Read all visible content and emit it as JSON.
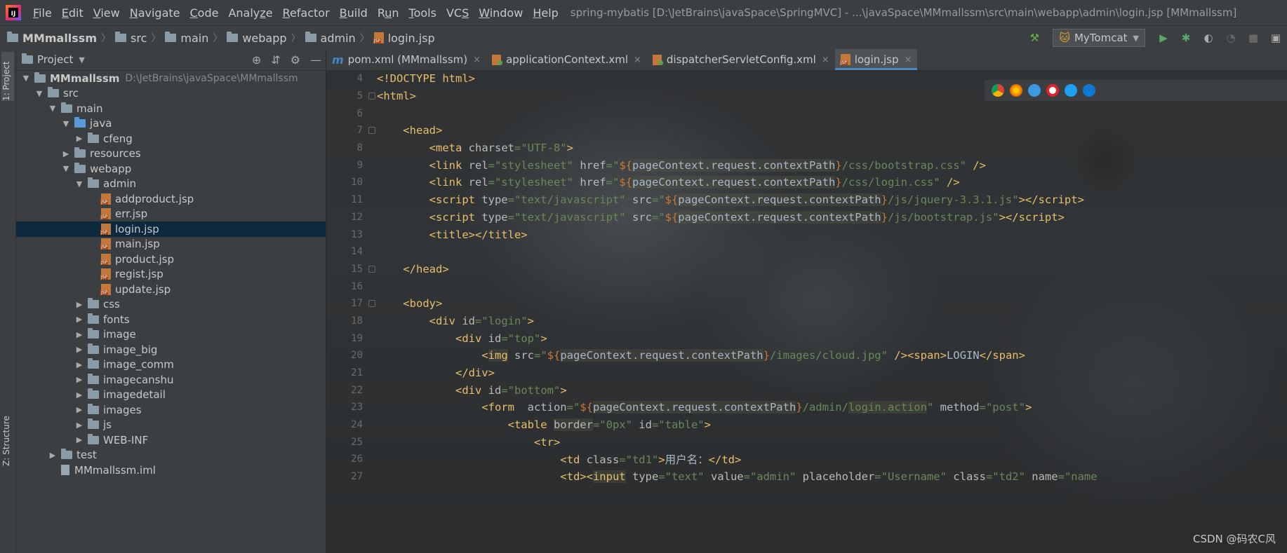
{
  "menubar": {
    "items": [
      "File",
      "Edit",
      "View",
      "Navigate",
      "Code",
      "Analyze",
      "Refactor",
      "Build",
      "Run",
      "Tools",
      "VCS",
      "Window",
      "Help"
    ],
    "mnemonics": [
      "F",
      "E",
      "V",
      "N",
      "C",
      "z",
      "R",
      "B",
      "u",
      "T",
      "S",
      "W",
      "H"
    ],
    "title": "spring-mybatis [D:\\JetBrains\\javaSpace\\SpringMVC] - ...\\javaSpace\\MMmallssm\\src\\main\\webapp\\admin\\login.jsp [MMmallssm]"
  },
  "breadcrumb": {
    "items": [
      "MMmallssm",
      "src",
      "main",
      "webapp",
      "admin",
      "login.jsp"
    ]
  },
  "toolbar": {
    "run_config": "MyTomcat",
    "icons": [
      "hammer-icon",
      "run-icon",
      "debug-icon",
      "coverage-icon",
      "profile-icon",
      "stop-icon"
    ]
  },
  "left_strip": {
    "project_tab": "1: Project",
    "structure_tab": "Z: Structure"
  },
  "project_panel": {
    "title": "Project",
    "root_path": "D:\\JetBrains\\javaSpace\\MMmallssm",
    "tree": [
      {
        "label": "MMmallssm",
        "depth": 0,
        "expanded": true,
        "bold": true
      },
      {
        "label": "src",
        "depth": 1,
        "expanded": true
      },
      {
        "label": "main",
        "depth": 2,
        "expanded": true
      },
      {
        "label": "java",
        "depth": 3,
        "expanded": true
      },
      {
        "label": "cfeng",
        "depth": 4,
        "expanded": false
      },
      {
        "label": "resources",
        "depth": 3,
        "expanded": false
      },
      {
        "label": "webapp",
        "depth": 3,
        "expanded": true
      },
      {
        "label": "admin",
        "depth": 4,
        "expanded": true
      },
      {
        "label": "addproduct.jsp",
        "depth": 5
      },
      {
        "label": "err.jsp",
        "depth": 5
      },
      {
        "label": "login.jsp",
        "depth": 5,
        "selected": true
      },
      {
        "label": "main.jsp",
        "depth": 5
      },
      {
        "label": "product.jsp",
        "depth": 5
      },
      {
        "label": "regist.jsp",
        "depth": 5
      },
      {
        "label": "update.jsp",
        "depth": 5
      },
      {
        "label": "css",
        "depth": 4,
        "expanded": false
      },
      {
        "label": "fonts",
        "depth": 4,
        "expanded": false
      },
      {
        "label": "image",
        "depth": 4,
        "expanded": false
      },
      {
        "label": "image_big",
        "depth": 4,
        "expanded": false
      },
      {
        "label": "image_comm",
        "depth": 4,
        "expanded": false
      },
      {
        "label": "imagecanshu",
        "depth": 4,
        "expanded": false
      },
      {
        "label": "imagedetail",
        "depth": 4,
        "expanded": false
      },
      {
        "label": "images",
        "depth": 4,
        "expanded": false
      },
      {
        "label": "js",
        "depth": 4,
        "expanded": false
      },
      {
        "label": "WEB-INF",
        "depth": 4,
        "expanded": false
      },
      {
        "label": "test",
        "depth": 2,
        "expanded": false
      },
      {
        "label": "MMmallssm.iml",
        "depth": 2
      }
    ]
  },
  "editor": {
    "tabs": [
      {
        "label": "pom.xml (MMmallssm)",
        "icon": "maven-icon",
        "active": false
      },
      {
        "label": "applicationContext.xml",
        "icon": "xml-icon",
        "active": false
      },
      {
        "label": "dispatcherServletConfig.xml",
        "icon": "xml-icon",
        "active": false
      },
      {
        "label": "login.jsp",
        "icon": "jsp-icon",
        "active": true
      }
    ],
    "close_glyph": "×",
    "lines": [
      {
        "n": "4",
        "html": "<span class='t'>&lt;!DOCTYPE html&gt;</span>"
      },
      {
        "n": "5",
        "html": "<span class='t'>&lt;html&gt;</span>"
      },
      {
        "n": "6",
        "html": ""
      },
      {
        "n": "7",
        "html": "    <span class='t'>&lt;head&gt;</span>"
      },
      {
        "n": "8",
        "html": "        <span class='t'>&lt;meta </span><span class='a'>charset</span><span class='s'>=\"UTF-8\"</span><span class='t'>&gt;</span>"
      },
      {
        "n": "9",
        "html": "        <span class='t'>&lt;link </span><span class='a'>rel</span><span class='s'>=\"stylesheet\" </span><span class='a'>href</span><span class='s'>=\"</span><span class='e'>${</span><span class='x hl'>pageContext.request.contextPath</span><span class='e'>}</span><span class='s'>/css/bootstrap.css\" </span><span class='t'>/&gt;</span>"
      },
      {
        "n": "10",
        "html": "        <span class='t'>&lt;link </span><span class='a'>rel</span><span class='s'>=\"stylesheet\" </span><span class='a'>href</span><span class='s'>=\"</span><span class='e'>${</span><span class='x hl'>pageContext.request.contextPath</span><span class='e'>}</span><span class='s'>/css/login.css\" </span><span class='t'>/&gt;</span>"
      },
      {
        "n": "11",
        "html": "        <span class='t'>&lt;script </span><span class='a'>type</span><span class='s'>=\"text/javascript\" </span><span class='a'>src</span><span class='s'>=\"</span><span class='e'>${</span><span class='x hl'>pageContext.request.contextPath</span><span class='e'>}</span><span class='s'>/js/jquery-3.3.1.js\"</span><span class='t'>&gt;&lt;/script&gt;</span>"
      },
      {
        "n": "12",
        "html": "        <span class='t'>&lt;script </span><span class='a'>type</span><span class='s'>=\"text/javascript\" </span><span class='a'>src</span><span class='s'>=\"</span><span class='e'>${</span><span class='x hl'>pageContext.request.contextPath</span><span class='e'>}</span><span class='s'>/js/bootstrap.js\"</span><span class='t'>&gt;&lt;/script&gt;</span>"
      },
      {
        "n": "13",
        "html": "        <span class='t'>&lt;title&gt;&lt;/title&gt;</span>"
      },
      {
        "n": "14",
        "html": ""
      },
      {
        "n": "15",
        "html": "    <span class='t'>&lt;/head&gt;</span>"
      },
      {
        "n": "16",
        "html": ""
      },
      {
        "n": "17",
        "html": "    <span class='t'>&lt;body&gt;</span>"
      },
      {
        "n": "18",
        "html": "        <span class='t'>&lt;div </span><span class='a'>id</span><span class='s'>=\"login\"</span><span class='t'>&gt;</span>"
      },
      {
        "n": "19",
        "html": "            <span class='t'>&lt;div </span><span class='a'>id</span><span class='s'>=\"top\"</span><span class='t'>&gt;</span>"
      },
      {
        "n": "20",
        "html": "                <span class='t'>&lt;<span class='hl'>img</span> </span><span class='a'>src</span><span class='s'>=\"</span><span class='e'>${</span><span class='x hl'>pageContext.request.contextPath</span><span class='e'>}</span><span class='s'>/images/cloud.jpg\" </span><span class='t'>/&gt;&lt;span&gt;</span><span class='x'>LOGIN</span><span class='t'>&lt;/span&gt;</span>"
      },
      {
        "n": "21",
        "html": "            <span class='t'>&lt;/div&gt;</span>"
      },
      {
        "n": "22",
        "html": "            <span class='t'>&lt;div </span><span class='a'>id</span><span class='s'>=\"bottom\"</span><span class='t'>&gt;</span>"
      },
      {
        "n": "23",
        "html": "                <span class='t'>&lt;form  </span><span class='a'>action</span><span class='s'>=\"</span><span class='e'>${</span><span class='x hl'>pageContext.request.contextPath</span><span class='e'>}</span><span class='s'>/admin/<span class='hl'>login.action</span>\" </span><span class='a'>method</span><span class='s'>=\"post\"</span><span class='t'>&gt;</span>"
      },
      {
        "n": "24",
        "html": "                    <span class='t'>&lt;table </span><span class='a hl'>border</span><span class='s'>=\"0px\" </span><span class='a'>id</span><span class='s'>=\"table\"</span><span class='t'>&gt;</span>"
      },
      {
        "n": "25",
        "html": "                        <span class='t'>&lt;tr&gt;</span>"
      },
      {
        "n": "26",
        "html": "                            <span class='t'>&lt;td </span><span class='a'>class</span><span class='s'>=\"td1\"</span><span class='t'>&gt;</span><span class='x'>用户名：</span><span class='t'>&lt;/td&gt;</span>"
      },
      {
        "n": "27",
        "html": "                            <span class='t'>&lt;td&gt;&lt;<span class='hl'>input</span> </span><span class='a'>type</span><span class='s'>=\"text\" </span><span class='a'>value</span><span class='s'>=\"admin\" </span><span class='a'>placeholder</span><span class='s'>=\"Username\" </span><span class='a'>class</span><span class='s'>=\"td2\" </span><span class='a'>name</span><span class='s'>=\"name</span>"
      }
    ]
  },
  "browser_icons": [
    "chrome-icon",
    "firefox-icon",
    "safari-icon",
    "opera-icon",
    "ie-icon",
    "edge-icon"
  ],
  "watermark": "CSDN @码农C风"
}
